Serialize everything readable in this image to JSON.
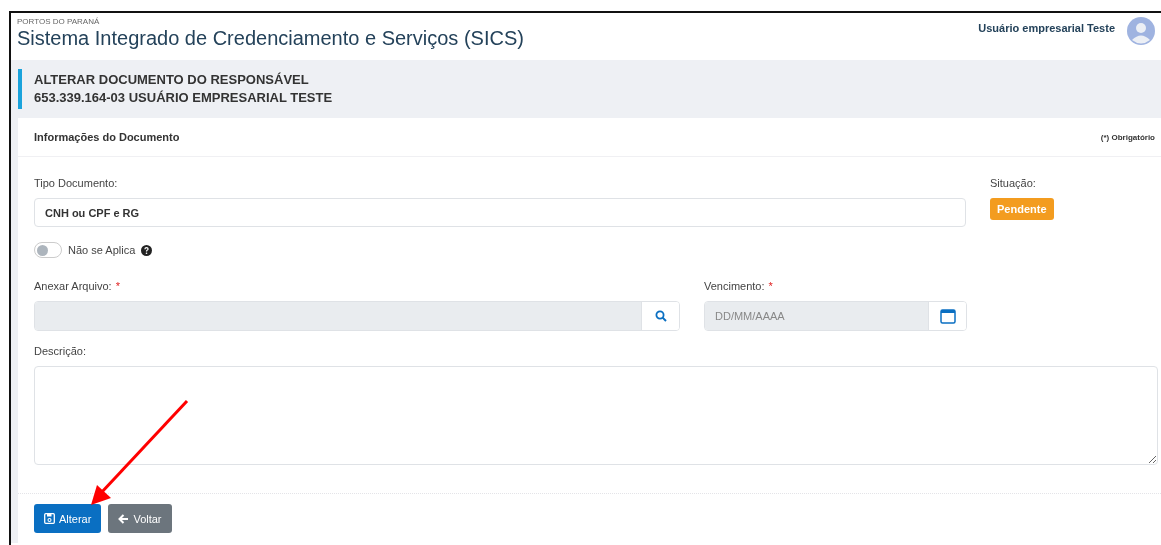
{
  "header": {
    "organization": "PORTOS DO PARANÁ",
    "title": "Sistema Integrado de Credenciamento e Serviços (SICS)",
    "user_name": "Usuário empresarial Teste"
  },
  "page_heading": {
    "lines": [
      "ALTERAR DOCUMENTO DO RESPONSÁVEL",
      "653.339.164-03 USUÁRIO EMPRESARIAL TESTE"
    ]
  },
  "card": {
    "title": "Informações do Documento",
    "required_note": "(*) Obrigatório"
  },
  "document_type": {
    "label": "Tipo Documento:",
    "value": "CNH ou CPF e RG"
  },
  "status": {
    "label": "Situação:",
    "value": "Pendente",
    "color": "#f39c1f"
  },
  "not_applicable": {
    "label": "Não se Aplica",
    "on": false
  },
  "attachment": {
    "label": "Anexar Arquivo:",
    "required_mark": "*"
  },
  "due_date": {
    "label": "Vencimento:",
    "required_mark": "*",
    "placeholder": "DD/MM/AAAA"
  },
  "description": {
    "label": "Descrição:"
  },
  "buttons": [
    {
      "kind": "primary",
      "label": "Alterar"
    },
    {
      "kind": "secondary",
      "label": "Voltar"
    }
  ]
}
